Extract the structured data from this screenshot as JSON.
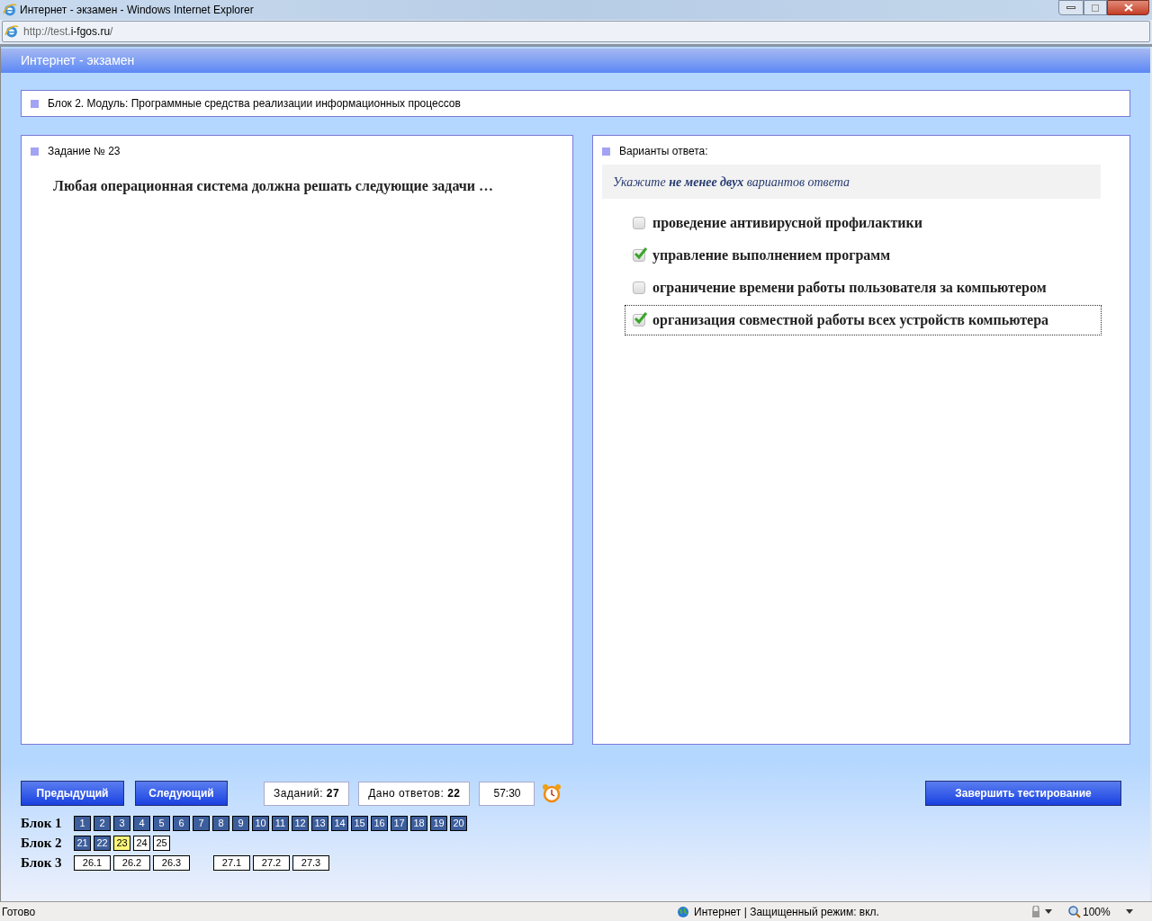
{
  "window": {
    "title": "Интернет - экзамен - Windows Internet Explorer"
  },
  "address_bar": {
    "prefix": "http://test.",
    "domain": "i-fgos.ru",
    "suffix": "/"
  },
  "page_header": "Интернет - экзамен",
  "module": "Блок 2. Модуль: Программные средства реализации информационных процессов",
  "task": {
    "title": "Задание № 23",
    "question": "Любая операционная система должна решать следующие задачи …"
  },
  "answers": {
    "title": "Варианты ответа:",
    "hint": "Укажите **не менее двух** вариантов ответа",
    "options": [
      {
        "text": "проведение антивирусной профилактики",
        "checked": false,
        "focused": false
      },
      {
        "text": "управление выполнением программ",
        "checked": true,
        "focused": false
      },
      {
        "text": "ограничение времени работы пользователя за компьютером",
        "checked": false,
        "focused": false
      },
      {
        "text": "организация совместной работы всех устройств компьютера",
        "checked": true,
        "focused": true
      }
    ]
  },
  "footer": {
    "prev_button": "Предыдущий",
    "next_button": "Следующий",
    "tasks_label": "Заданий:",
    "tasks_value": "27",
    "answered_label": "Дано ответов:",
    "answered_value": "22",
    "timer": "57:30",
    "finish_button": "Завершить тестирование"
  },
  "blocks": [
    {
      "label": "Блок 1",
      "groups": [
        [
          {
            "label": "1",
            "answered": true,
            "selected": false
          },
          {
            "label": "2",
            "answered": true,
            "selected": false
          },
          {
            "label": "3",
            "answered": true,
            "selected": false
          },
          {
            "label": "4",
            "answered": true,
            "selected": false
          },
          {
            "label": "5",
            "answered": true,
            "selected": false
          },
          {
            "label": "6",
            "answered": true,
            "selected": false
          },
          {
            "label": "7",
            "answered": true,
            "selected": false
          },
          {
            "label": "8",
            "answered": true,
            "selected": false
          },
          {
            "label": "9",
            "answered": true,
            "selected": false
          },
          {
            "label": "10",
            "answered": true,
            "selected": false
          },
          {
            "label": "11",
            "answered": true,
            "selected": false
          },
          {
            "label": "12",
            "answered": true,
            "selected": false
          },
          {
            "label": "13",
            "answered": true,
            "selected": false
          },
          {
            "label": "14",
            "answered": true,
            "selected": false
          },
          {
            "label": "15",
            "answered": true,
            "selected": false
          },
          {
            "label": "16",
            "answered": true,
            "selected": false
          },
          {
            "label": "17",
            "answered": true,
            "selected": false
          },
          {
            "label": "18",
            "answered": true,
            "selected": false
          },
          {
            "label": "19",
            "answered": true,
            "selected": false
          },
          {
            "label": "20",
            "answered": true,
            "selected": false
          }
        ]
      ]
    },
    {
      "label": "Блок 2",
      "groups": [
        [
          {
            "label": "21",
            "answered": true,
            "selected": false
          },
          {
            "label": "22",
            "answered": true,
            "selected": false
          },
          {
            "label": "23",
            "answered": false,
            "selected": true
          },
          {
            "label": "24",
            "answered": false,
            "selected": false
          },
          {
            "label": "25",
            "answered": false,
            "selected": false
          }
        ]
      ]
    },
    {
      "label": "Блок 3",
      "groups": [
        [
          {
            "label": "26.1",
            "answered": false,
            "selected": false
          },
          {
            "label": "26.2",
            "answered": false,
            "selected": false
          },
          {
            "label": "26.3",
            "answered": false,
            "selected": false
          }
        ],
        [
          {
            "label": "27.1",
            "answered": false,
            "selected": false
          },
          {
            "label": "27.2",
            "answered": false,
            "selected": false
          },
          {
            "label": "27.3",
            "answered": false,
            "selected": false
          }
        ]
      ]
    }
  ],
  "status_bar": {
    "text": "Готово",
    "zone": "Интернет | Защищенный режим: вкл.",
    "zoom": "100%"
  }
}
